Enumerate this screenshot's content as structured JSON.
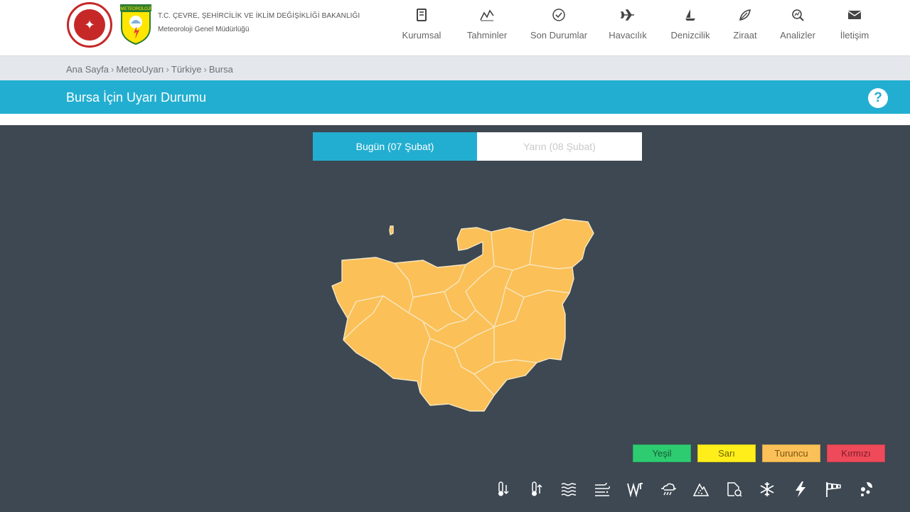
{
  "header": {
    "org_line1": "T.C. ÇEVRE, ŞEHİRCİLİK VE İKLİM DEĞİŞİKLİĞİ BAKANLIĞI",
    "org_line2": "Meteoroloji Genel Müdürlüğü",
    "logo_mgm_text": "METEOROLOJİ"
  },
  "nav": [
    {
      "label": "Kurumsal",
      "icon": "book-icon"
    },
    {
      "label": "Tahminler",
      "icon": "chart-line-icon"
    },
    {
      "label": "Son Durumlar",
      "icon": "check-circle-icon"
    },
    {
      "label": "Havacılık",
      "icon": "plane-icon"
    },
    {
      "label": "Denizcilik",
      "icon": "sailboat-icon"
    },
    {
      "label": "Ziraat",
      "icon": "leaf-icon"
    },
    {
      "label": "Analizler",
      "icon": "search-chart-icon"
    },
    {
      "label": "İletişim",
      "icon": "envelope-icon"
    }
  ],
  "breadcrumb": [
    "Ana Sayfa",
    "MeteoUyarı",
    "Türkiye",
    "Bursa"
  ],
  "title": "Bursa İçin Uyarı Durumu",
  "help_label": "?",
  "tabs": {
    "today": "Bugün (07 Şubat)",
    "tomorrow": "Yarın (08 Şubat)"
  },
  "map": {
    "region": "Bursa",
    "fill_color": "#fbc057",
    "warning_level": "Turuncu"
  },
  "legend": [
    {
      "label": "Yeşil",
      "color": "#2ecc71"
    },
    {
      "label": "Sarı",
      "color": "#ffee1a"
    },
    {
      "label": "Turuncu",
      "color": "#fbc057"
    },
    {
      "label": "Kırmızı",
      "color": "#ef4a5a"
    }
  ],
  "hazard_icons": [
    "cold-temperature-icon",
    "hot-temperature-icon",
    "fog-icon",
    "sandstorm-icon",
    "wind-icon",
    "rain-icon",
    "avalanche-icon",
    "dust-icon",
    "snow-icon",
    "lightning-icon",
    "windsock-icon",
    "hail-icon"
  ]
}
